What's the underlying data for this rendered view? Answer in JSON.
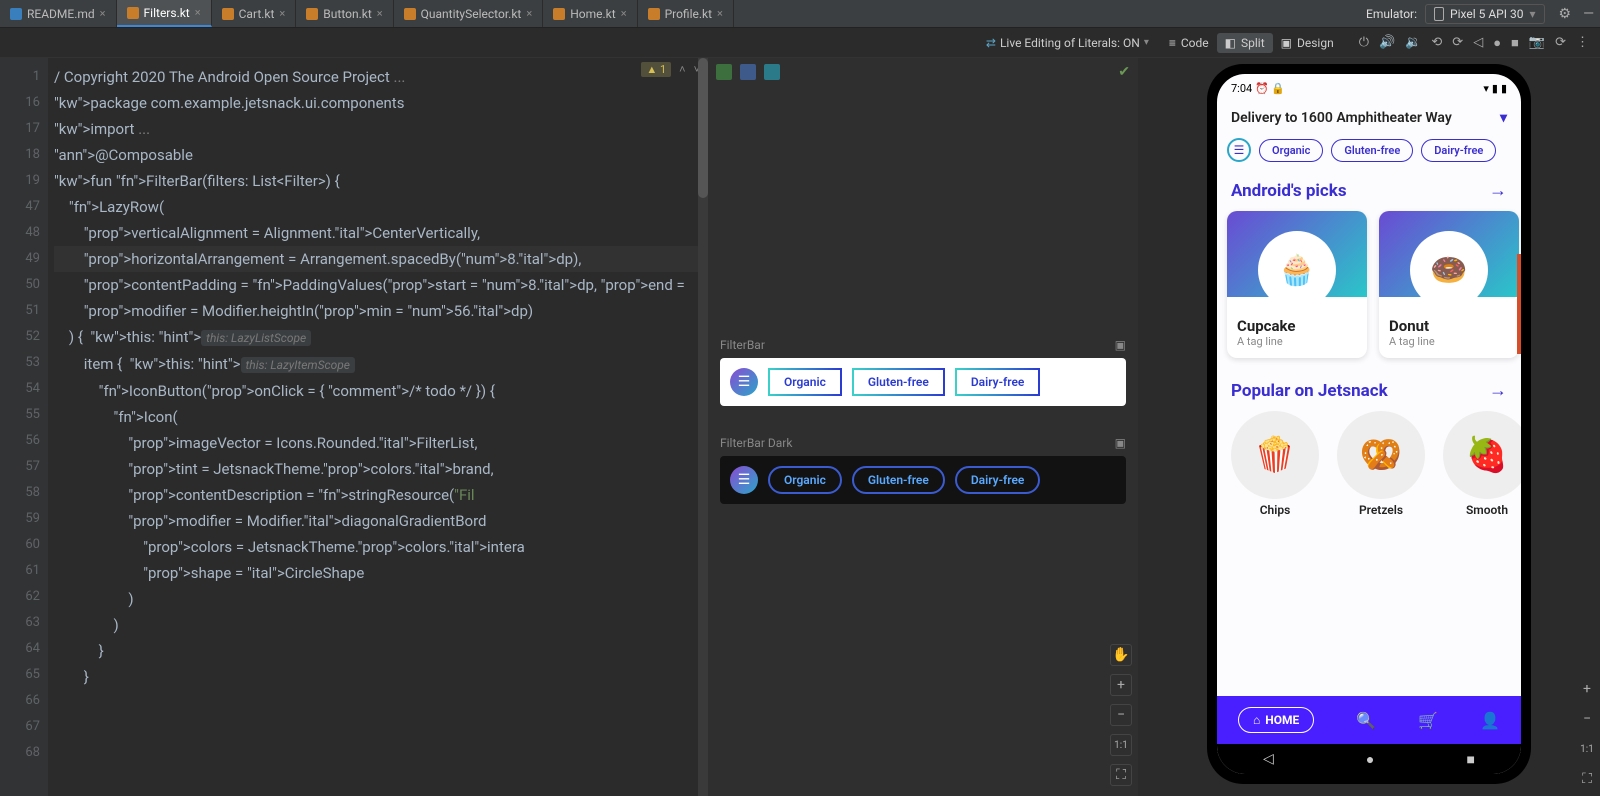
{
  "tabs": [
    {
      "name": "README.md",
      "kind": "md"
    },
    {
      "name": "Filters.kt",
      "kind": "kt",
      "active": true
    },
    {
      "name": "Cart.kt",
      "kind": "kt"
    },
    {
      "name": "Button.kt",
      "kind": "kt"
    },
    {
      "name": "QuantitySelector.kt",
      "kind": "kt"
    },
    {
      "name": "Home.kt",
      "kind": "kt"
    },
    {
      "name": "Profile.kt",
      "kind": "kt"
    }
  ],
  "emulator": {
    "label": "Emulator:",
    "device": "Pixel 5 API 30"
  },
  "toolbar": {
    "live_edit": "Live Editing of Literals: ON",
    "code": "Code",
    "split": "Split",
    "design": "Design"
  },
  "editor": {
    "warning_count": "1",
    "lines": [
      "1",
      "16",
      "17",
      "18",
      "19",
      "47",
      "48",
      "49",
      "50",
      "51",
      "52",
      "53",
      "54",
      "55",
      "56",
      "57",
      "58",
      "59",
      "60",
      "61",
      "62",
      "63",
      "64",
      "65",
      "66",
      "67",
      "68"
    ],
    "code_rows": [
      "/ Copyright 2020 The Android Open Source Project ...",
      "",
      "package com.example.jetsnack.ui.components",
      "",
      "import ...",
      "",
      "@Composable",
      "fun FilterBar(filters: List<Filter>) {",
      "    LazyRow(",
      "        verticalAlignment = Alignment.CenterVertically,",
      "        horizontalArrangement = Arrangement.spacedBy(8.dp),",
      "        contentPadding = PaddingValues(start = 8.dp, end = ",
      "        modifier = Modifier.heightIn(min = 56.dp)",
      "    ) {  this: LazyListScope",
      "        item {  this: LazyItemScope",
      "            IconButton(onClick = { /* todo */ }) {",
      "                Icon(",
      "                    imageVector = Icons.Rounded.FilterList,",
      "                    tint = JetsnackTheme.colors.brand,",
      "                    contentDescription = stringResource(\"Fil",
      "                    modifier = Modifier.diagonalGradientBord",
      "                        colors = JetsnackTheme.colors.intera",
      "                        shape = CircleShape",
      "                    )",
      "                )",
      "            }",
      "        }"
    ]
  },
  "preview": {
    "label_light": "FilterBar",
    "label_dark": "FilterBar Dark",
    "chips": [
      "Organic",
      "Gluten-free",
      "Dairy-free"
    ],
    "one_to_one": "1:1"
  },
  "phone": {
    "time": "7:04",
    "header": "Delivery to 1600 Amphitheater Way",
    "chips": [
      "Organic",
      "Gluten-free",
      "Dairy-free"
    ],
    "section1": "Android's picks",
    "cards": [
      {
        "name": "Cupcake",
        "tag": "A tag line",
        "emoji": "🧁"
      },
      {
        "name": "Donut",
        "tag": "A tag line",
        "emoji": "🍩"
      }
    ],
    "section2": "Popular on Jetsnack",
    "circles": [
      {
        "label": "Chips",
        "emoji": "🍿"
      },
      {
        "label": "Pretzels",
        "emoji": "🥨"
      },
      {
        "label": "Smooth",
        "emoji": "🍓"
      }
    ],
    "nav_home": "HOME"
  },
  "emu_side": {
    "one_to_one": "1:1"
  }
}
